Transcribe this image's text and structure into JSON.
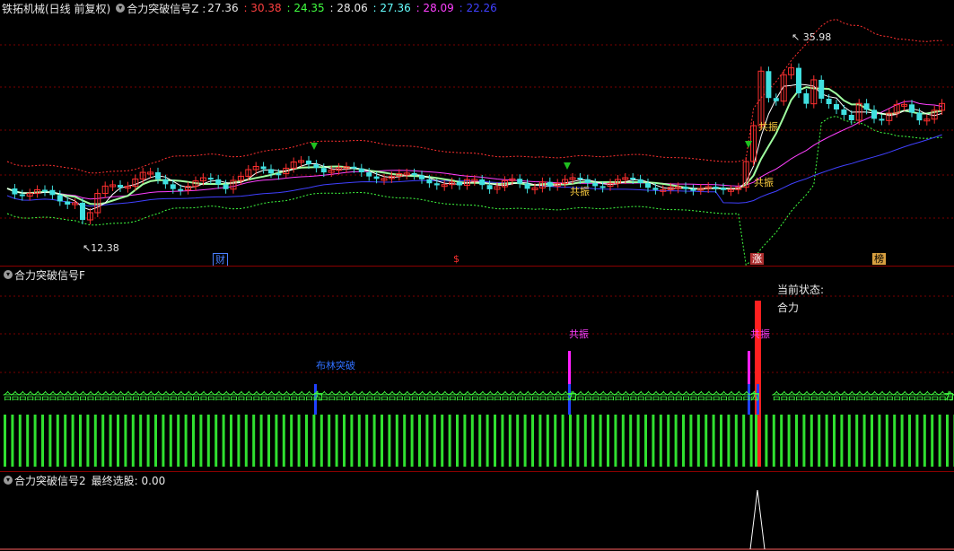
{
  "main": {
    "title": "铁拓机械(日线 前复权)",
    "indicator": "合力突破信号Z :",
    "values": [
      {
        "text": "27.36",
        "color": "#e8e8e8"
      },
      {
        "text": ": 30.38",
        "color": "#ff4040"
      },
      {
        "text": ": 24.35",
        "color": "#40ff40"
      },
      {
        "text": ": 28.06",
        "color": "#e8e8e8"
      },
      {
        "text": ": 27.36",
        "color": "#66ffff"
      },
      {
        "text": ": 28.09",
        "color": "#ff40ff"
      },
      {
        "text": ": 22.26",
        "color": "#4040ff"
      }
    ],
    "high_label": "35.98",
    "low_label": "12.38",
    "signal_labels": [
      "共振",
      "共振",
      "共振"
    ],
    "markers": [
      {
        "text": "财",
        "color": "#4a7fff"
      },
      {
        "text": "$",
        "color": "#ff3030"
      },
      {
        "text": "涨",
        "color": "#ff3030"
      },
      {
        "text": "榜",
        "color": "#ffd040"
      }
    ]
  },
  "sub1": {
    "title": "合力突破信号F",
    "labels": {
      "breakout": "布林突破",
      "resonance1": "共振",
      "resonance2": "共振",
      "state_title": "当前状态:",
      "state_value": "合力"
    },
    "repeat_text": "合",
    "repeat_text2": "力"
  },
  "sub2": {
    "title": "合力突破信号2",
    "metric": "最终选股: 0.00"
  }
}
